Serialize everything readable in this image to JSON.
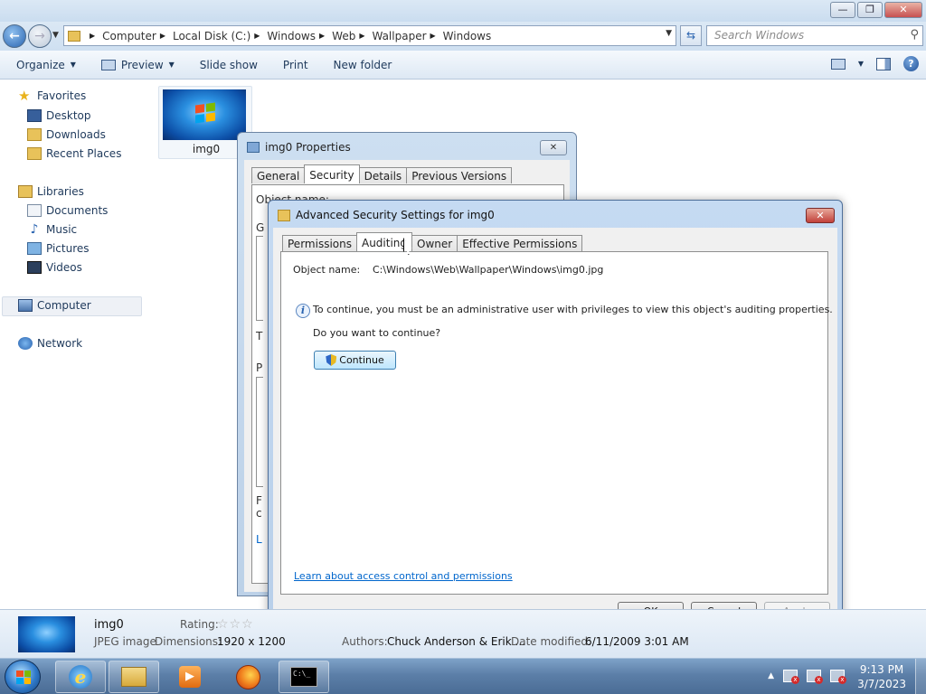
{
  "window": {
    "minimize": "—",
    "maximize": "❐",
    "close": "✕"
  },
  "address": {
    "crumbs": [
      "Computer",
      "Local Disk (C:)",
      "Windows",
      "Web",
      "Wallpaper",
      "Windows"
    ],
    "search_placeholder": "Search Windows"
  },
  "toolbar": {
    "organize": "Organize",
    "preview": "Preview",
    "slideshow": "Slide show",
    "print": "Print",
    "new_folder": "New folder"
  },
  "nav": {
    "favorites": "Favorites",
    "desktop": "Desktop",
    "downloads": "Downloads",
    "recent": "Recent Places",
    "libraries": "Libraries",
    "documents": "Documents",
    "music": "Music",
    "pictures": "Pictures",
    "videos": "Videos",
    "computer": "Computer",
    "network": "Network"
  },
  "file": {
    "name": "img0"
  },
  "properties_dialog": {
    "title": "img0 Properties",
    "tabs": [
      "General",
      "Security",
      "Details",
      "Previous Versions"
    ],
    "active_tab": "Security",
    "fragments": {
      "obj": "Object name:",
      "g": "G",
      "t": "T",
      "p": "P",
      "f": "F",
      "c": "c",
      "l": "L"
    }
  },
  "advanced_dialog": {
    "title": "Advanced Security Settings for img0",
    "tabs": [
      "Permissions",
      "Auditing",
      "Owner",
      "Effective Permissions"
    ],
    "active_tab": "Auditing",
    "object_name_label": "Object name:",
    "object_name_value": "C:\\Windows\\Web\\Wallpaper\\Windows\\img0.jpg",
    "message": "To continue, you must be an administrative user with privileges to view this object's auditing properties.",
    "question": "Do you want to continue?",
    "continue_label": "Continue",
    "learn_link": "Learn about access control and permissions",
    "ok": "OK",
    "cancel": "Cancel",
    "apply": "Apply"
  },
  "details": {
    "name": "img0",
    "type": "JPEG image",
    "rating_label": "Rating:",
    "dimensions_label": "Dimensions:",
    "dimensions_value": "1920 x 1200",
    "authors_label": "Authors:",
    "authors_value": "Chuck Anderson & Erik ...",
    "date_label": "Date modified:",
    "date_value": "6/11/2009 3:01 AM"
  },
  "taskbar": {
    "time": "9:13 PM",
    "date": "3/7/2023",
    "cmd_text": "C:\\_"
  }
}
